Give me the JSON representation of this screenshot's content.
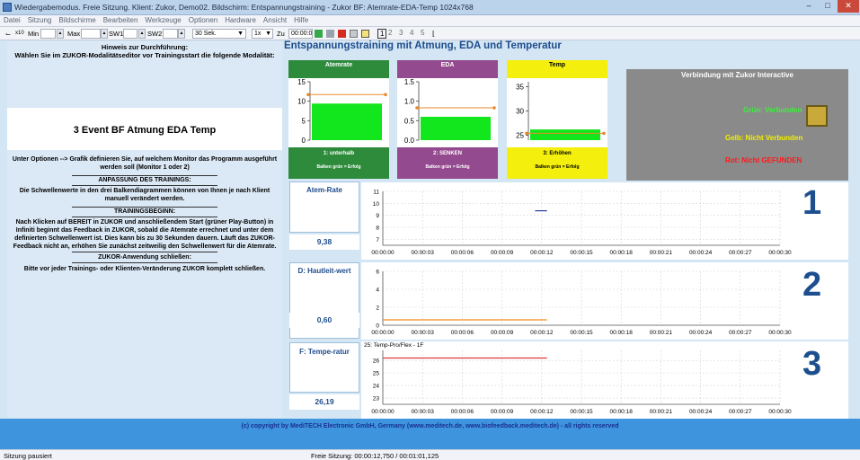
{
  "window": {
    "title": "Wiedergabemodus. Freie Sitzung. Klient: Zukor, Demo02. Bildschirm: Entspannungstraining - Zukor BF: Atemrate-EDA-Temp 1024x768"
  },
  "menu": [
    "Datei",
    "Sitzung",
    "Bildschirme",
    "Bearbeiten",
    "Werkzeuge",
    "Optionen",
    "Hardware",
    "Ansicht",
    "Hilfe"
  ],
  "toolbar": {
    "scale_label": "x10",
    "min_label": "Min",
    "max_label": "Max",
    "sw1_label": "SW1",
    "sw2_label": "SW2",
    "duration": "30 Sek.",
    "speed": "1x",
    "zu_label": "Zu",
    "time": "00:00:0",
    "pages": [
      "1",
      "2",
      "3",
      "4",
      "5"
    ]
  },
  "left": {
    "hint_title": "Hinweis zur Durchführung:",
    "hint_text": "Wählen Sie im ZUKOR-Modalitätseditor vor Trainingsstart die folgende Modalität:",
    "event_name": "3 Event BF Atmung EDA Temp",
    "options_text": "Unter Optionen --> Grafik definieren Sie, auf welchem Monitor das Programm ausgeführt werden soll (Monitor 1 oder 2)",
    "adapt_title": "ANPASSUNG DES TRAININGS:",
    "adapt_text": "Die Schwellenwerte in den drei Balkendiagrammen können von Ihnen je nach Klient manuell verändert werden.",
    "begin_title": "TRAININGSBEGINN:",
    "begin_text": "Nach Klicken auf BEREIT in ZUKOR und anschließendem Start (grüner Play-Button) in Infiniti beginnt das Feedback in ZUKOR, sobald die Atemrate errechnet und unter dem definierten Schwellenwert ist. Dies kann bis zu 30 Sekunden dauern. Läuft das ZUKOR-Feedback nicht an, erhöhen Sie zunächst zeitweilig den Schwellenwert für die Atemrate.",
    "close_title": "ZUKOR-Anwendung schließen:",
    "close_text": "Bitte vor jeder Trainings- oder Klienten-Veränderung ZUKOR komplett schließen."
  },
  "heading": "Entspannungstraining mit Atmung, EDA und Temperatur",
  "panels": [
    {
      "title": "Atemrate",
      "color": "#2e8b3c",
      "ticks": [
        "15",
        "10",
        "5",
        "0"
      ],
      "bar_value": 9.4,
      "threshold": 11.7,
      "ymin": 0,
      "ymax": 15,
      "foot1": "1: unterhalb",
      "foot2": "Balken grün = Erfolg"
    },
    {
      "title": "EDA",
      "color": "#944a8e",
      "ticks": [
        "1.5",
        "1.0",
        "0.5",
        "0.0"
      ],
      "bar_value": 0.6,
      "threshold": 0.83,
      "ymin": 0,
      "ymax": 1.5,
      "foot1": "2: SENKEN",
      "foot2": "Balken grün = Erfolg"
    },
    {
      "title": "Temp",
      "color": "#f4ef0c",
      "ticks": [
        "35",
        "30",
        "25"
      ],
      "bar_value": 26.2,
      "threshold": 25.4,
      "ymin": 24,
      "ymax": 36,
      "foot1": "3: Erhöhen",
      "foot2": "Balken grün = Erfolg"
    }
  ],
  "connection": {
    "title": "Verbindung mit Zukor Interactive",
    "green": "Grün: Verbunden",
    "yellow": "Gelb: Nicht Verbunden",
    "red": "Rot: Nicht GEFUNDEN"
  },
  "rows": [
    {
      "label": "Atem-Rate",
      "value": "9,38",
      "number": "1"
    },
    {
      "label": "D: Hautleit-wert",
      "value": "0,60",
      "number": "2"
    },
    {
      "label": "F: Tempe-ratur",
      "value": "26,19",
      "number": "3"
    }
  ],
  "graph3_title": "25: Temp-Pro/Flex - 1F",
  "x_ticks": [
    "00:00:00",
    "00:00:03",
    "00:00:06",
    "00:00:09",
    "00:00:12",
    "00:00:15",
    "00:00:18",
    "00:00:21",
    "00:00:24",
    "00:00:27",
    "00:00:30"
  ],
  "graphs": [
    {
      "ticks": [
        "11",
        "10",
        "9",
        "8",
        "7"
      ],
      "ymin": 6.5,
      "ymax": 11,
      "series_color": "#2b3a9e",
      "seg_x": [
        11.5,
        12.4
      ],
      "seg_y": 9.38
    },
    {
      "ticks": [
        "6",
        "4",
        "2",
        "0"
      ],
      "ymin": 0,
      "ymax": 6,
      "series_color": "#f08a1c",
      "seg_x": [
        0,
        12.4
      ],
      "seg_y": 0.6
    },
    {
      "ticks": [
        "26",
        "25",
        "24",
        "23"
      ],
      "ymin": 22.5,
      "ymax": 26.8,
      "series_color": "#e03a3a",
      "seg_x": [
        0,
        12.4
      ],
      "seg_y": 26.19
    }
  ],
  "copyright": "(c) copyright by MediTECH Electronic GmbH, Germany (www.meditech.de, www.biofeedback.meditech.de) - all rights reserved",
  "status": {
    "left": "Sitzung pausiert",
    "mid": "Freie Sitzung: 00:00:12,750 / 00:01:01,125"
  }
}
